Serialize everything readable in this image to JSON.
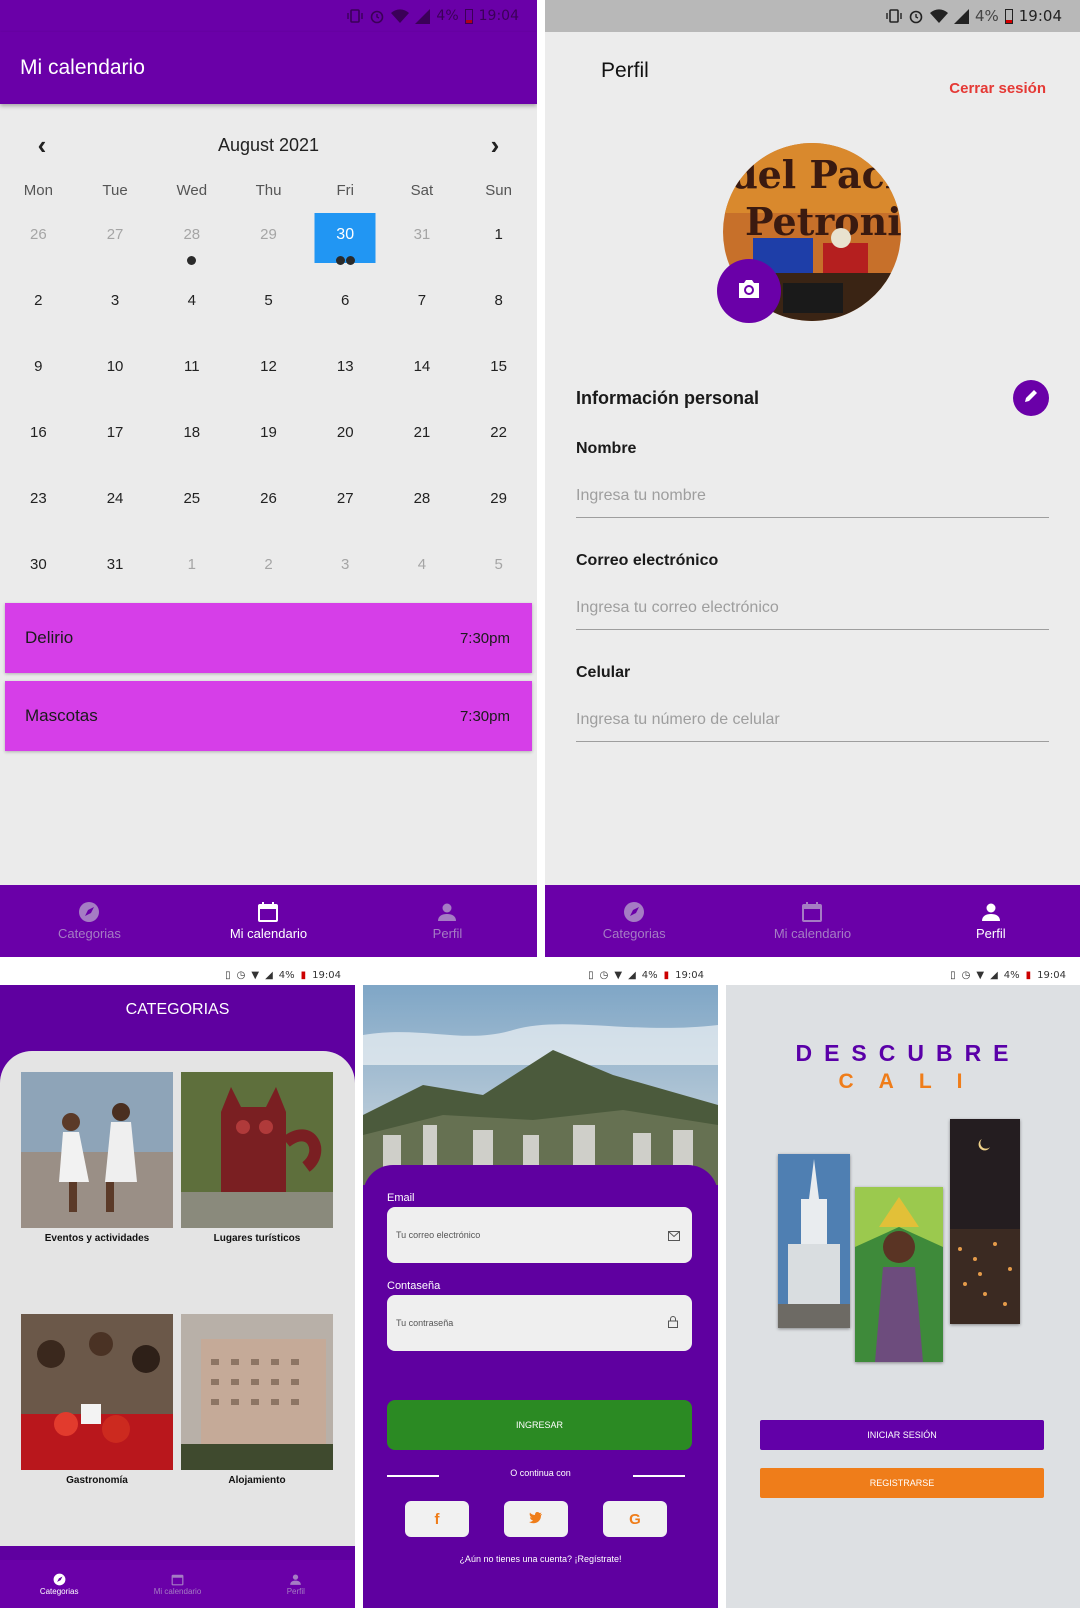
{
  "status_bar": {
    "time": "19:04",
    "battery": "4%"
  },
  "calendar_screen": {
    "app_title": "Mi calendario",
    "month_label": "August 2021",
    "prev_icon": "chevron-left-icon",
    "next_icon": "chevron-right-icon",
    "weekdays": [
      "Mon",
      "Tue",
      "Wed",
      "Thu",
      "Fri",
      "Sat",
      "Sun"
    ],
    "days": [
      {
        "n": "26",
        "muted": true
      },
      {
        "n": "27",
        "muted": true
      },
      {
        "n": "28",
        "muted": true,
        "dots": 1
      },
      {
        "n": "29",
        "muted": true
      },
      {
        "n": "30",
        "selected": true,
        "dots": 2
      },
      {
        "n": "31",
        "muted": true
      },
      {
        "n": "1"
      },
      {
        "n": "2"
      },
      {
        "n": "3"
      },
      {
        "n": "4"
      },
      {
        "n": "5"
      },
      {
        "n": "6"
      },
      {
        "n": "7"
      },
      {
        "n": "8"
      },
      {
        "n": "9"
      },
      {
        "n": "10"
      },
      {
        "n": "11"
      },
      {
        "n": "12"
      },
      {
        "n": "13"
      },
      {
        "n": "14"
      },
      {
        "n": "15"
      },
      {
        "n": "16"
      },
      {
        "n": "17"
      },
      {
        "n": "18"
      },
      {
        "n": "19"
      },
      {
        "n": "20"
      },
      {
        "n": "21"
      },
      {
        "n": "22"
      },
      {
        "n": "23"
      },
      {
        "n": "24"
      },
      {
        "n": "25"
      },
      {
        "n": "26"
      },
      {
        "n": "27"
      },
      {
        "n": "28"
      },
      {
        "n": "29"
      },
      {
        "n": "30"
      },
      {
        "n": "31"
      },
      {
        "n": "1",
        "muted": true
      },
      {
        "n": "2",
        "muted": true
      },
      {
        "n": "3",
        "muted": true
      },
      {
        "n": "4",
        "muted": true
      },
      {
        "n": "5",
        "muted": true
      }
    ],
    "events": [
      {
        "name": "Delirio",
        "time": "7:30pm"
      },
      {
        "name": "Mascotas",
        "time": "7:30pm"
      }
    ]
  },
  "bottom_nav": {
    "categorias": "Categorias",
    "mi_calendario": "Mi calendario",
    "perfil": "Perfil"
  },
  "profile_screen": {
    "title": "Perfil",
    "logout": "Cerrar sesión",
    "section_title": "Información personal",
    "fields": {
      "nombre": {
        "label": "Nombre",
        "placeholder": "Ingresa tu nombre"
      },
      "correo": {
        "label": "Correo electrónico",
        "placeholder": "Ingresa tu correo electrónico"
      },
      "celular": {
        "label": "Celular",
        "placeholder": "Ingresa tu número de celular"
      }
    }
  },
  "categories_screen": {
    "title": "CATEGORIAS",
    "cards": [
      "Eventos y actividades",
      "Lugares turísticos",
      "Gastronomía",
      "Alojamiento"
    ]
  },
  "login_screen": {
    "email_label": "Email",
    "email_placeholder": "Tu correo electrónico",
    "password_label": "Contaseña",
    "password_placeholder": "Tu contraseña",
    "login_button": "INGRESAR",
    "or_text": "O continua con",
    "social": [
      "f",
      "t",
      "G"
    ],
    "register_link": "¿Aún no tienes una cuenta? ¡Regístrate!"
  },
  "welcome_screen": {
    "title_line1": "DESCUBRE",
    "title_line2": "CALI",
    "login_button": "INICIAR SESIÓN",
    "register_button": "REGISTRARSE"
  },
  "colors": {
    "primary": "#6a00a8",
    "accent": "#ef7d1a",
    "event": "#d63ee8",
    "selected": "#2196f3",
    "danger": "#e53935",
    "success": "#2b8a23"
  }
}
